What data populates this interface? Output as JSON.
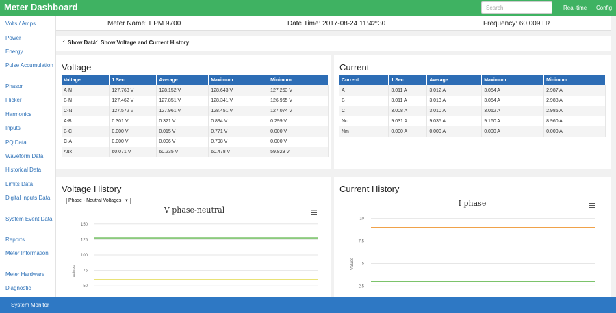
{
  "header": {
    "brand": "Meter Dashboard",
    "search_placeholder": "Search",
    "nav": [
      "Real-time",
      "Config"
    ]
  },
  "sidebar": {
    "items": [
      "Volts / Amps",
      "Power",
      "Energy",
      "Pulse Accumulation",
      "Phasor",
      "Flicker",
      "Harmonics",
      "Inputs",
      "PQ Data",
      "Waveform Data",
      "Historical Data",
      "Limits Data",
      "Digital Inputs Data",
      "System Event Data",
      "Reports",
      "Meter Information",
      "Meter Hardware",
      "Diagnostic"
    ]
  },
  "info": {
    "meter_name": "Meter Name: EPM 9700",
    "date_time": "Date Time: 2017-08-24 11:42:30",
    "frequency": "Frequency: 60.009 Hz"
  },
  "options": {
    "show_data": "Show Data",
    "show_vc_history": "Show Voltage and Current History",
    "checkmark": "✓"
  },
  "voltage": {
    "title": "Voltage",
    "headers": [
      "Voltage",
      "1 Sec",
      "Average",
      "Maximum",
      "Minimum"
    ],
    "rows": [
      [
        "A-N",
        "127.763 V",
        "128.152 V",
        "128.643 V",
        "127.263 V"
      ],
      [
        "B-N",
        "127.462 V",
        "127.851 V",
        "128.341 V",
        "126.965 V"
      ],
      [
        "C-N",
        "127.572 V",
        "127.961 V",
        "128.451 V",
        "127.074 V"
      ],
      [
        "A-B",
        "0.301 V",
        "0.321 V",
        "0.894 V",
        "0.299 V"
      ],
      [
        "B-C",
        "0.000 V",
        "0.015 V",
        "0.771 V",
        "0.000 V"
      ],
      [
        "C-A",
        "0.000 V",
        "0.006 V",
        "0.798 V",
        "0.000 V"
      ],
      [
        "Aux",
        "60.071 V",
        "60.235 V",
        "60.478 V",
        "59.829 V"
      ]
    ]
  },
  "current": {
    "title": "Current",
    "headers": [
      "Current",
      "1 Sec",
      "Average",
      "Maximum",
      "Minimum"
    ],
    "rows": [
      [
        "A",
        "3.011 A",
        "3.012 A",
        "3.054 A",
        "2.987 A"
      ],
      [
        "B",
        "3.011 A",
        "3.013 A",
        "3.054 A",
        "2.988 A"
      ],
      [
        "C",
        "3.008 A",
        "3.010 A",
        "3.052 A",
        "2.985 A"
      ],
      [
        "Nc",
        "9.031 A",
        "9.035 A",
        "9.160 A",
        "8.960 A"
      ],
      [
        "Nm",
        "0.000 A",
        "0.000 A",
        "0.000 A",
        "0.000 A"
      ]
    ]
  },
  "voltage_history": {
    "title": "Voltage History",
    "select_value": "Phase - Neutral Voltages"
  },
  "current_history": {
    "title": "Current History"
  },
  "chart_data": [
    {
      "type": "line",
      "title": "V phase-neutral",
      "ylabel": "Values",
      "yticks": [
        50,
        75,
        100,
        125,
        150
      ],
      "ylim": [
        48,
        152
      ],
      "series": [
        {
          "values": [
            127.6,
            127.6
          ],
          "color": "#7cc36b"
        },
        {
          "values": [
            60.1,
            60.1
          ],
          "color": "#e2d84a"
        }
      ]
    },
    {
      "type": "line",
      "title": "I phase",
      "ylabel": "Values",
      "yticks": [
        2.5,
        5,
        7.5,
        10
      ],
      "ylim": [
        2.3,
        10.2
      ],
      "series": [
        {
          "values": [
            9.0,
            9.0
          ],
          "color": "#f0a24a"
        },
        {
          "values": [
            3.0,
            3.0
          ],
          "color": "#7cc36b"
        }
      ]
    }
  ],
  "footer": {
    "text": "System Monitor"
  },
  "colors": {
    "header_green": "#3fb262",
    "table_blue": "#2d6db5",
    "footer_blue": "#2e78c4",
    "link_blue": "#2f72b8"
  }
}
